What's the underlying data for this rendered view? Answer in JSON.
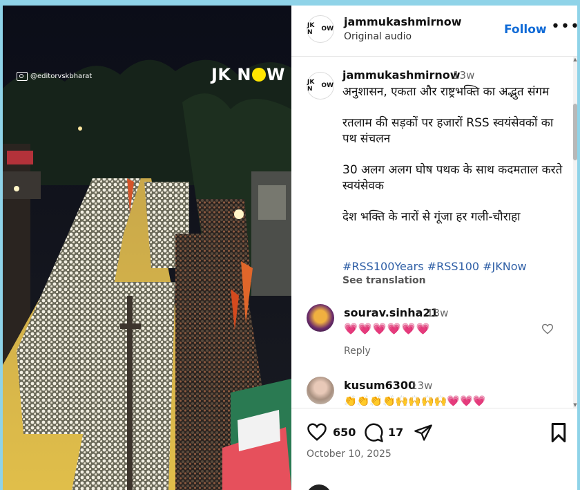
{
  "media": {
    "watermark": "@editorvskbharat",
    "overlay_logo_left": "JK N",
    "overlay_logo_right": "W"
  },
  "header": {
    "logo_left": "JK N",
    "logo_right": "W",
    "username": "jammukashmirnow",
    "audio": "Original audio",
    "follow_label": "Follow",
    "more_label": "•••"
  },
  "caption": {
    "username": "jammukashmirnow",
    "time": "13w",
    "lines": [
      "अनुशासन, एकता और राष्ट्रभक्ति का अद्भुत संगम",
      "रतलाम की सड़कों पर हजारों RSS स्वयंसेवकों का पथ संचलन",
      "30 अलग अलग घोष पथक के साथ कदमताल करते स्वयंसेवक",
      "देश भक्ति के नारों से गूंजा हर गली-चौराहा"
    ],
    "hashtags": "#RSS100Years #RSS100  #JKNow",
    "see_translation": "See translation"
  },
  "comments": [
    {
      "username": "sourav.sinha21",
      "time": "13w",
      "text": "💗💗💗💗💗💗",
      "reply_label": "Reply"
    },
    {
      "username": "kusum6300",
      "time": "13w",
      "text": "👏👏👏👏🙌🙌🙌🙌💗💗💗"
    }
  ],
  "actions": {
    "likes": "650",
    "comments": "17",
    "date": "October 10, 2025"
  },
  "colors": {
    "accent": "#0f6ad6",
    "hashtag": "#2f5fa6",
    "logo_dot": "#ffe500",
    "background": "#8fd3e8"
  }
}
